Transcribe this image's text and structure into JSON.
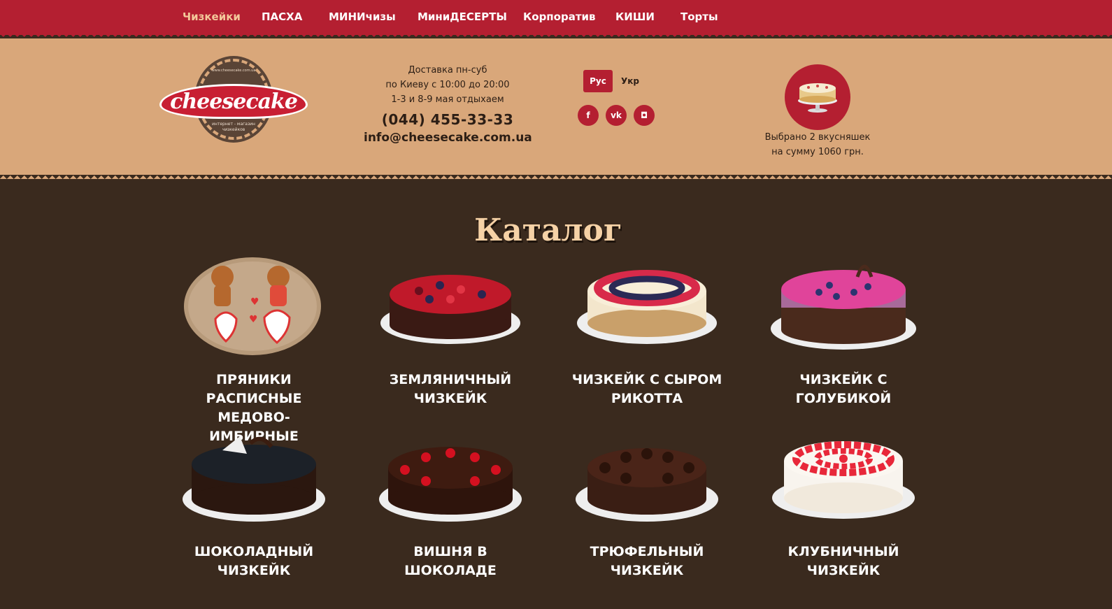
{
  "nav": {
    "items": [
      {
        "label": "Чизкейки",
        "active": true
      },
      {
        "label": "ПАСХА",
        "active": false
      },
      {
        "label": "МИНИчизы",
        "active": false
      },
      {
        "label": "МиниДЕСЕРТЫ",
        "active": false
      },
      {
        "label": "Корпоратив",
        "active": false
      },
      {
        "label": "КИШИ",
        "active": false
      },
      {
        "label": "Торты",
        "active": false
      }
    ]
  },
  "logo": {
    "url": "www.cheesecake.com.ua",
    "name": "cheesecake",
    "subtitle_line1": "интернет - магазин",
    "subtitle_line2": "чизкейков"
  },
  "contacts": {
    "delivery_line1": "Доставка пн-суб",
    "delivery_line2": "по Киеву с 10:00 до 20:00",
    "delivery_line3": "1-3 и 8-9 мая отдыхаем",
    "phone": "(044) 455-33-33",
    "email": "info@cheesecake.com.ua"
  },
  "lang": {
    "ru": "Рус",
    "uk": "Укр"
  },
  "social": {
    "facebook": "f",
    "vk": "vk",
    "instagram": "◘"
  },
  "cart": {
    "line1": "Выбрано 2 вкусняшек",
    "line2": "на сумму 1060 грн."
  },
  "catalog": {
    "title": "Каталог",
    "products": [
      {
        "name": "ПРЯНИКИ РАСПИСНЫЕ МЕДОВО-ИМБИРНЫЕ",
        "image": "gingerbread"
      },
      {
        "name": "ЗЕМЛЯНИЧНЫЙ ЧИЗКЕЙК",
        "image": "berry-cake"
      },
      {
        "name": "ЧИЗКЕЙК С СЫРОМ РИКОТТА",
        "image": "ricotta-cake"
      },
      {
        "name": "ЧИЗКЕЙК С ГОЛУБИКОЙ",
        "image": "blueberry-cake"
      },
      {
        "name": "ШОКОЛАДНЫЙ ЧИЗКЕЙК",
        "image": "chocolate-cake"
      },
      {
        "name": "ВИШНЯ В ШОКОЛАДЕ",
        "image": "cherry-chocolate-cake"
      },
      {
        "name": "ТРЮФЕЛЬНЫЙ ЧИЗКЕЙК",
        "image": "truffle-cake"
      },
      {
        "name": "КЛУБНИЧНЫЙ ЧИЗКЕЙК",
        "image": "strawberry-cake"
      }
    ]
  },
  "colors": {
    "nav_bg": "#b41f31",
    "header_bg": "#d9a77a",
    "page_bg": "#3a2a1e",
    "title": "#f6d2a6"
  }
}
